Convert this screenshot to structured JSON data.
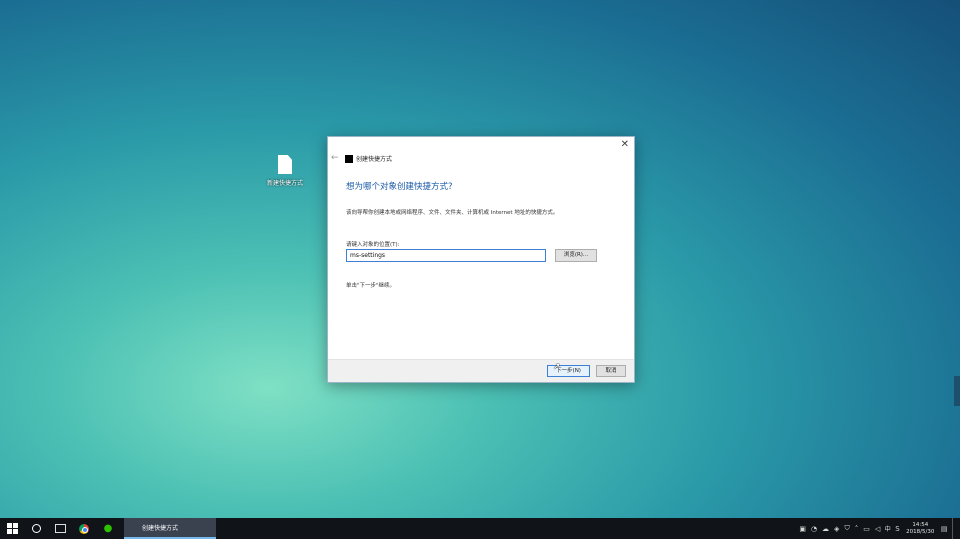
{
  "desktop": {
    "icon_label": "新建快捷方式"
  },
  "dialog": {
    "window_title": "创建快捷方式",
    "close_glyph": "✕",
    "back_glyph": "←",
    "heading": "想为哪个对象创建快捷方式?",
    "description": "该向导帮你创建本地或网络程序、文件、文件夹、计算机或 Internet 地址的快捷方式。",
    "location_label": "请键入对象的位置(T):",
    "location_value": "ms-settings",
    "browse_label": "浏览(R)...",
    "hint": "单击\"下一步\"继续。",
    "next_label": "下一步(N)",
    "cancel_label": "取消"
  },
  "taskbar": {
    "task_label": "创建快捷方式",
    "icons": [
      "windows-start-icon",
      "cortana-icon",
      "task-view-icon",
      "chrome-icon",
      "wechat-icon"
    ],
    "tray_icons": [
      "keyboard-icon",
      "wechat-tray-icon",
      "cloud-icon",
      "nvidia-icon",
      "shield-icon",
      "chevron-up-icon",
      "network-icon",
      "volume-icon"
    ],
    "ime_label": "中",
    "clock_time": "14:54",
    "clock_date": "2018/5/30"
  }
}
